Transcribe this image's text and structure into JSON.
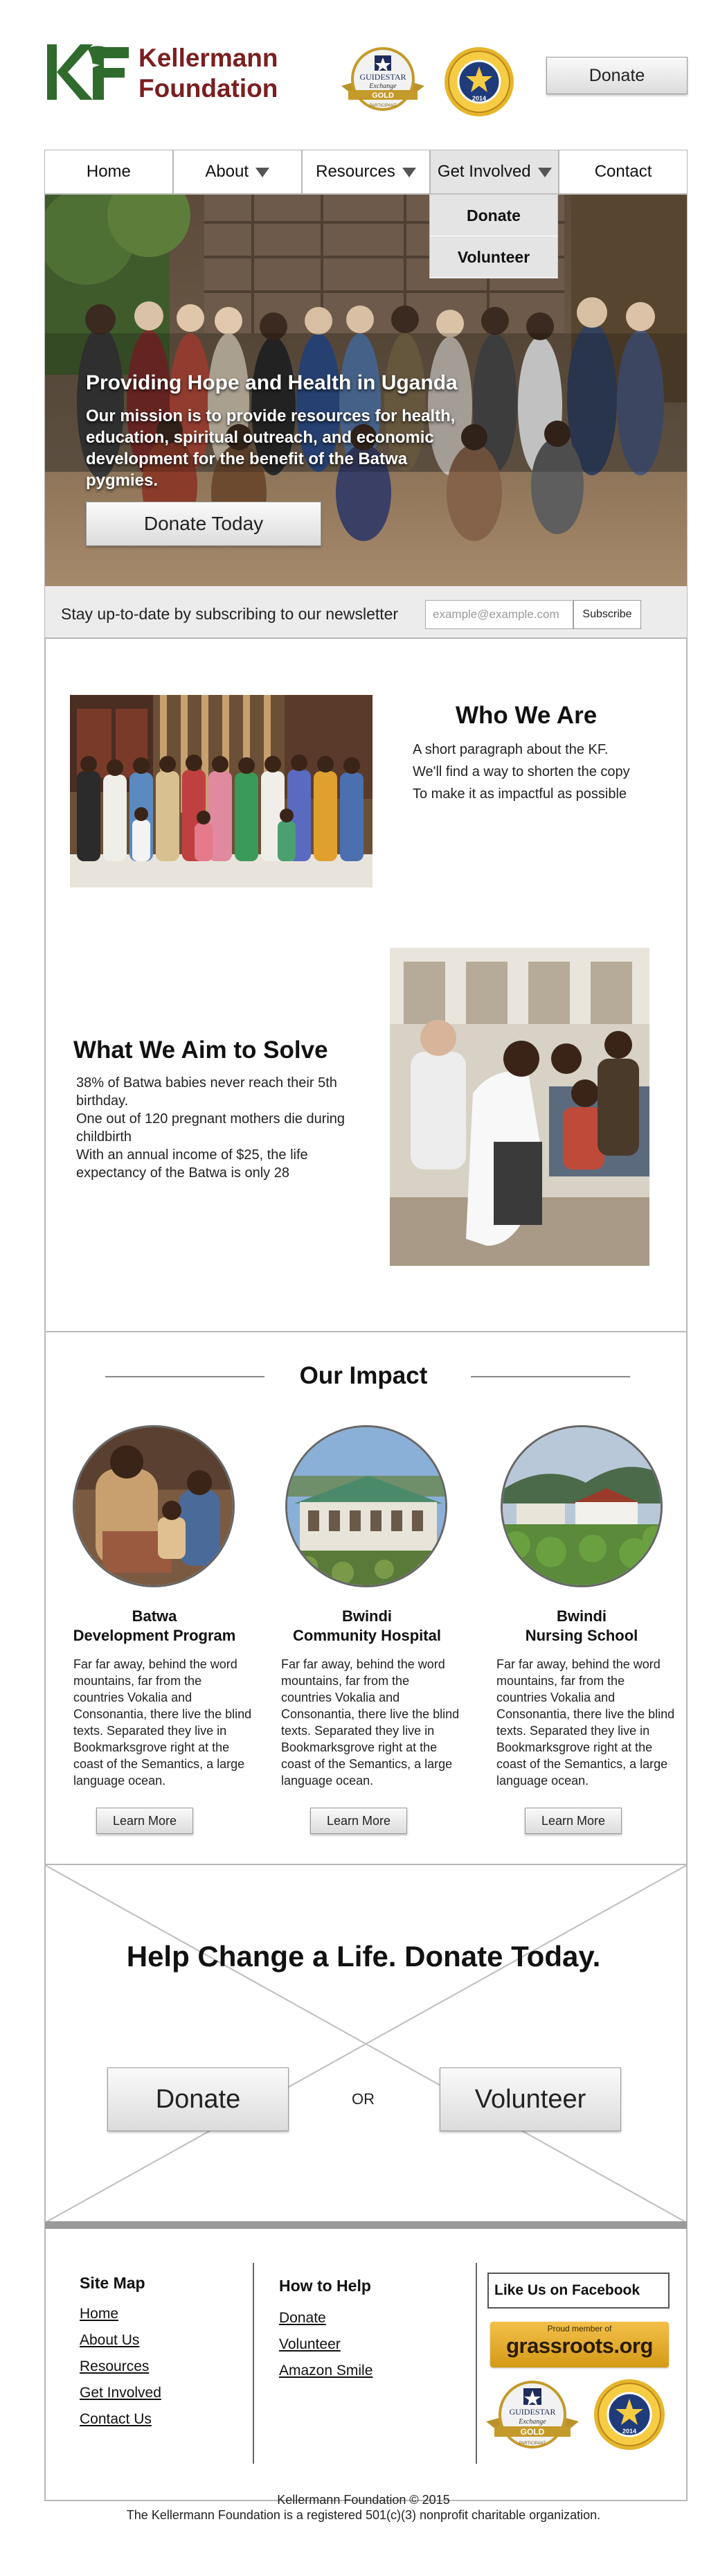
{
  "header": {
    "logo_mark": "KF",
    "logo_line1": "Kellermann",
    "logo_line2": "Foundation",
    "donate_label": "Donate",
    "guidestar": {
      "name": "GUIDESTAR",
      "sub": "Exchange",
      "level": "GOLD",
      "year": "PARTICIPANT"
    },
    "seal_year": "2014"
  },
  "nav": {
    "items": [
      {
        "label": "Home"
      },
      {
        "label": "About"
      },
      {
        "label": "Resources"
      },
      {
        "label": "Get Involved"
      },
      {
        "label": "Contact"
      }
    ],
    "dropdown": [
      "Donate",
      "Volunteer"
    ]
  },
  "hero": {
    "title": "Providing Hope and Health in Uganda",
    "text": "Our mission is to provide resources for health, education, spiritual outreach, and economic development for the benefit of the Batwa pygmies.",
    "button": "Donate Today"
  },
  "newsletter": {
    "text": "Stay up-to-date by subscribing to our newsletter",
    "placeholder": "example@example.com",
    "button": "Subscribe"
  },
  "who": {
    "title": "Who We Are",
    "lines": [
      "A short paragraph about the KF.",
      "We'll find a way to shorten the copy",
      "To make it as impactful as possible"
    ]
  },
  "aim": {
    "title": "What We Aim to Solve",
    "lines": [
      "38% of Batwa babies never reach their 5th birthday.",
      "One out of 120 pregnant mothers die during childbirth",
      "With an annual income of $25, the life expectancy of the Batwa is only 28"
    ]
  },
  "impact": {
    "title": "Our Impact",
    "learn_more": "Learn More",
    "programs": [
      {
        "line1": "Batwa",
        "line2": "Development Program",
        "text": "Far far away, behind the word mountains, far from the countries Vokalia and Consonantia, there live the blind texts. Separated they live in Bookmarksgrove right at the coast of the Semantics, a large language ocean."
      },
      {
        "line1": "Bwindi",
        "line2": "Community Hospital",
        "text": "Far far away, behind the word mountains, far from the countries Vokalia and Consonantia, there live the blind texts. Separated they live in Bookmarksgrove right at the coast of the Semantics, a large language ocean."
      },
      {
        "line1": "Bwindi",
        "line2": "Nursing School",
        "text": "Far far away, behind the word mountains, far from the countries Vokalia and Consonantia, there live the blind texts. Separated they live in Bookmarksgrove right at the coast of the Semantics, a large language ocean."
      }
    ]
  },
  "cta": {
    "title": "Help Change a Life. Donate Today.",
    "donate": "Donate",
    "or": "OR",
    "volunteer": "Volunteer"
  },
  "footer": {
    "sitemap_title": "Site Map",
    "sitemap": [
      "Home",
      "About Us",
      "Resources",
      "Get Involved",
      "Contact Us"
    ],
    "help_title": "How to Help",
    "help": [
      "Donate",
      "Volunteer",
      "Amazon Smile"
    ],
    "facebook": "Like Us on Facebook",
    "grassroots_small": "Proud member of",
    "grassroots_big": "grassroots.org",
    "copyright1": "Kellermann Foundation © 2015",
    "copyright2": "The Kellermann Foundation is a registered 501(c)(3) nonprofit charitable organization."
  },
  "colors": {
    "brand_green": "#2f6b2d",
    "brand_maroon": "#7a1f20",
    "wire_gray": "#b8b8b8",
    "gold": "#d4a017"
  }
}
